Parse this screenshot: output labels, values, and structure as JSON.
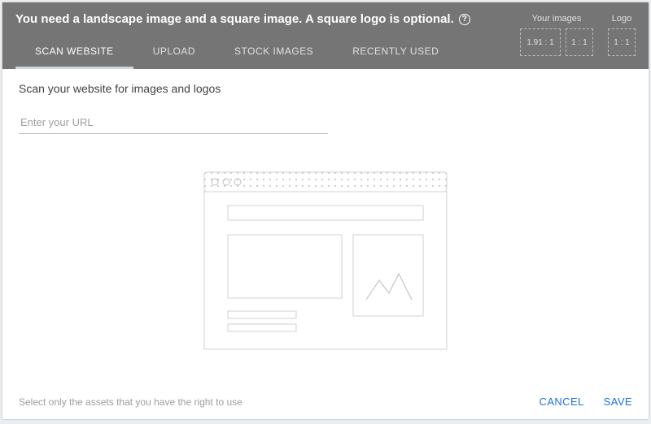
{
  "header": {
    "title": "You need a landscape image and a square image. A square logo is optional.",
    "help_icon": "?",
    "slots": {
      "images_label": "Your images",
      "logo_label": "Logo",
      "landscape_ratio": "1.91 : 1",
      "square_ratio": "1 : 1",
      "logo_ratio": "1 : 1"
    }
  },
  "tabs": [
    {
      "label": "SCAN WEBSITE",
      "active": true
    },
    {
      "label": "UPLOAD",
      "active": false
    },
    {
      "label": "STOCK IMAGES",
      "active": false
    },
    {
      "label": "RECENTLY USED",
      "active": false
    }
  ],
  "body": {
    "subtitle": "Scan your website for images and logos",
    "url_placeholder": "Enter your URL"
  },
  "footer": {
    "disclaimer": "Select only the assets that you have the right to use",
    "cancel": "CANCEL",
    "save": "SAVE"
  }
}
